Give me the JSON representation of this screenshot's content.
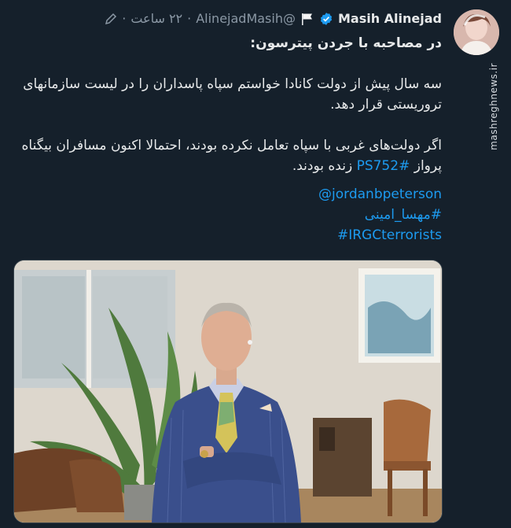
{
  "tweet": {
    "author_name": "Masih Alinejad",
    "handle": "@AlinejadMasih",
    "separator": "·",
    "time": "۲۲ ساعت",
    "intro": "در مصاحبه با جردن پیترسون:",
    "paragraph1": "سه سال پیش از دولت کانادا خواستم سپاه پاسداران را در لیست سازمانهای تروریستی قرار دهد.",
    "paragraph2_before": "اگر دولت‌های غربی با سپاه تعامل نکرده بودند، احتمالا اکنون مسافران بیگناه پرواز",
    "paragraph2_hashtag": "#PS752",
    "paragraph2_after": "زنده بودند.",
    "mention": "@jordanbpeterson",
    "hashtag_fa": "#مهسا_امینی",
    "hashtag_irgc": "#IRGCterrorists"
  },
  "watermark": "mashreghnews.ir",
  "icons": {
    "verified": "verified-badge-icon",
    "flag": "white-flag-icon",
    "edit": "pencil-edit-icon"
  },
  "colors": {
    "background": "#15202b",
    "text": "#e7e9ea",
    "muted": "#8b98a5",
    "link": "#1d9bf0",
    "verified": "#1d9bf0"
  }
}
